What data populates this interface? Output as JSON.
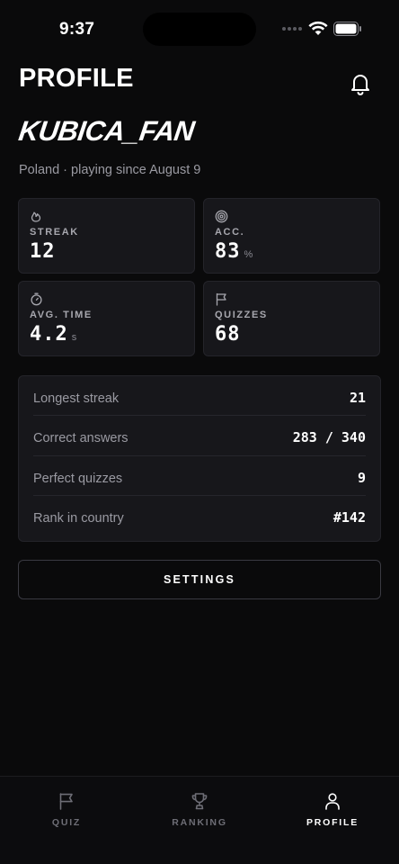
{
  "status_bar": {
    "time": "9:37"
  },
  "header": {
    "title": "PROFILE",
    "bell_icon": "bell-icon"
  },
  "profile": {
    "username": "KUBICA_FAN",
    "subtitle": "Poland · playing since August 9"
  },
  "stats": [
    {
      "icon": "flame-icon",
      "label": "STREAK",
      "value": "12",
      "unit": ""
    },
    {
      "icon": "target-icon",
      "label": "ACC.",
      "value": "83",
      "unit": "%"
    },
    {
      "icon": "stopwatch-icon",
      "label": "AVG. TIME",
      "value": "4.2",
      "unit": "s"
    },
    {
      "icon": "flag-icon",
      "label": "QUIZZES",
      "value": "68",
      "unit": ""
    }
  ],
  "details": [
    {
      "label": "Longest streak",
      "value": "21"
    },
    {
      "label": "Correct answers",
      "value": "283 / 340"
    },
    {
      "label": "Perfect quizzes",
      "value": "9"
    },
    {
      "label": "Rank in country",
      "value": "#142"
    }
  ],
  "settings_label": "SETTINGS",
  "tabs": [
    {
      "label": "QUIZ",
      "icon": "flag-icon",
      "active": false
    },
    {
      "label": "RANKING",
      "icon": "trophy-icon",
      "active": false
    },
    {
      "label": "PROFILE",
      "icon": "user-icon",
      "active": true
    }
  ],
  "colors": {
    "background": "#0a0a0b",
    "card": "#17171b",
    "muted_text": "#9a9aa2",
    "active_tab": "#ffffff",
    "inactive_tab": "#6e6e76"
  }
}
